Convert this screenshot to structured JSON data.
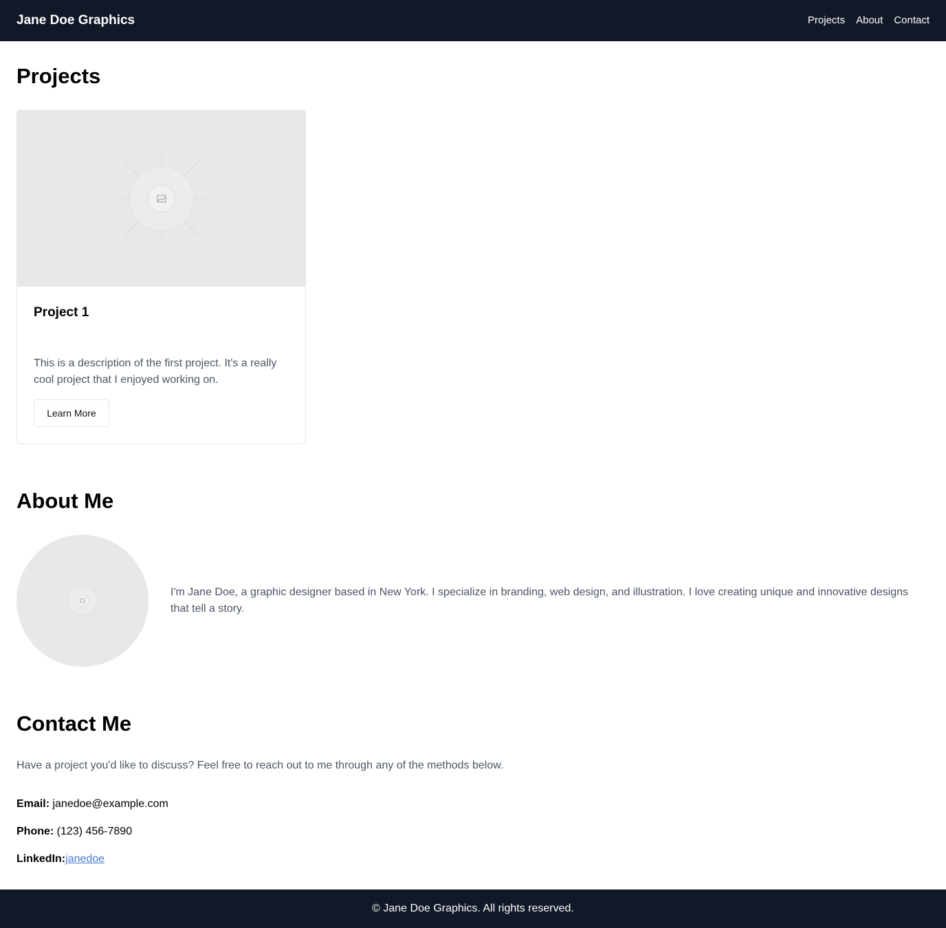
{
  "header": {
    "brand": "Jane Doe Graphics",
    "nav": [
      "Projects",
      "About",
      "Contact"
    ]
  },
  "projects": {
    "title": "Projects",
    "cards": [
      {
        "image_icon": "image-placeholder-icon",
        "title": "Project 1",
        "description": "This is a description of the first project. It's a really cool project that I enjoyed working on.",
        "button_label": "Learn More"
      }
    ]
  },
  "about": {
    "title": "About Me",
    "avatar_icon": "image-placeholder-icon",
    "text": "I'm Jane Doe, a graphic designer based in New York. I specialize in branding, web design, and illustration. I love creating unique and innovative designs that tell a story."
  },
  "contact": {
    "title": "Contact Me",
    "intro": "Have a project you'd like to discuss? Feel free to reach out to me through any of the methods below.",
    "email_label": "Email:",
    "email": "janedoe@example.com",
    "phone_label": "Phone:",
    "phone": "(123) 456-7890",
    "linkedin_label": "LinkedIn:",
    "linkedin": "janedoe"
  },
  "footer": {
    "text": "© Jane Doe Graphics. All rights reserved."
  },
  "colors": {
    "navbar_bg": "#111827",
    "link": "#4a7bd0",
    "muted_text": "#4b5563",
    "placeholder_bg": "#e8e8e8"
  }
}
